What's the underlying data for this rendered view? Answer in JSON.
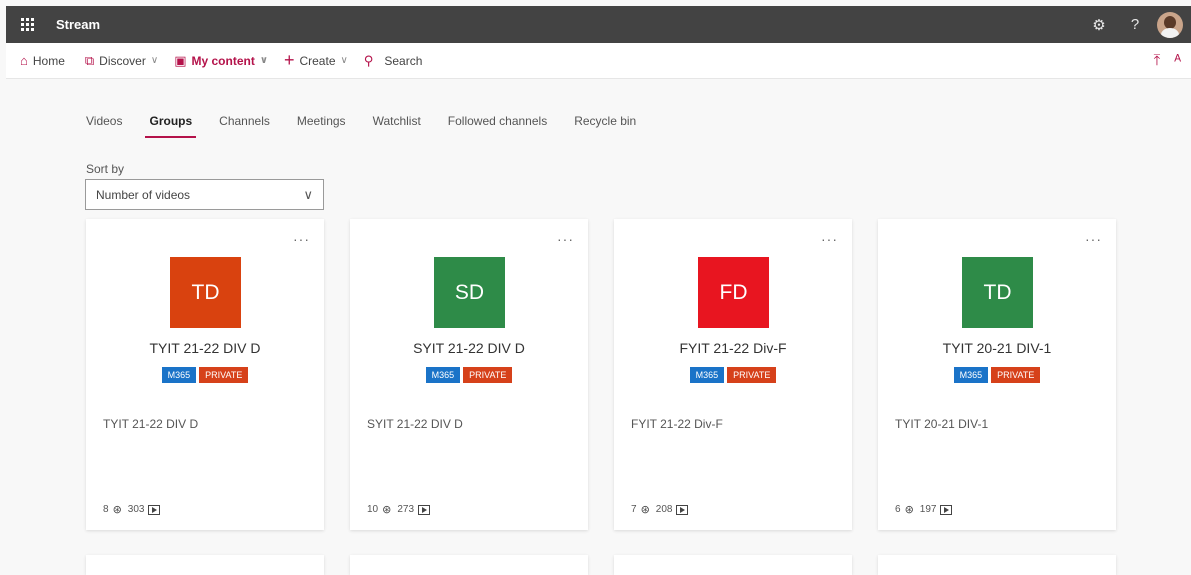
{
  "app": {
    "title": "Stream"
  },
  "topbar_icons": [
    "gear-icon",
    "help-icon"
  ],
  "nav": {
    "home": "Home",
    "discover": "Discover",
    "my_content": "My content",
    "create": "Create",
    "search": "Search"
  },
  "tabs": [
    "Videos",
    "Groups",
    "Channels",
    "Meetings",
    "Watchlist",
    "Followed channels",
    "Recycle bin"
  ],
  "active_tab": "Groups",
  "sort": {
    "label": "Sort by",
    "value": "Number of videos"
  },
  "badges": {
    "m365": "M365",
    "private": "PRIVATE"
  },
  "groups": [
    {
      "initials": "TD",
      "name": "TYIT 21-22 DIV D",
      "description": "TYIT 21-22 DIV D",
      "members": "8",
      "videos": "303",
      "color": "#d9420f"
    },
    {
      "initials": "SD",
      "name": "SYIT 21-22 DIV D",
      "description": "SYIT 21-22 DIV D",
      "members": "10",
      "videos": "273",
      "color": "#2e8b48"
    },
    {
      "initials": "FD",
      "name": "FYIT 21-22 Div-F",
      "description": "FYIT 21-22 Div-F",
      "members": "7",
      "videos": "208",
      "color": "#e81520"
    },
    {
      "initials": "TD",
      "name": "TYIT 20-21 DIV-1",
      "description": "TYIT 20-21 DIV-1",
      "members": "6",
      "videos": "197",
      "color": "#2e8b48"
    }
  ],
  "colors": {
    "accent": "#b4124a",
    "appbar": "#434343",
    "m365": "#1a73c8",
    "private": "#d6411a"
  }
}
